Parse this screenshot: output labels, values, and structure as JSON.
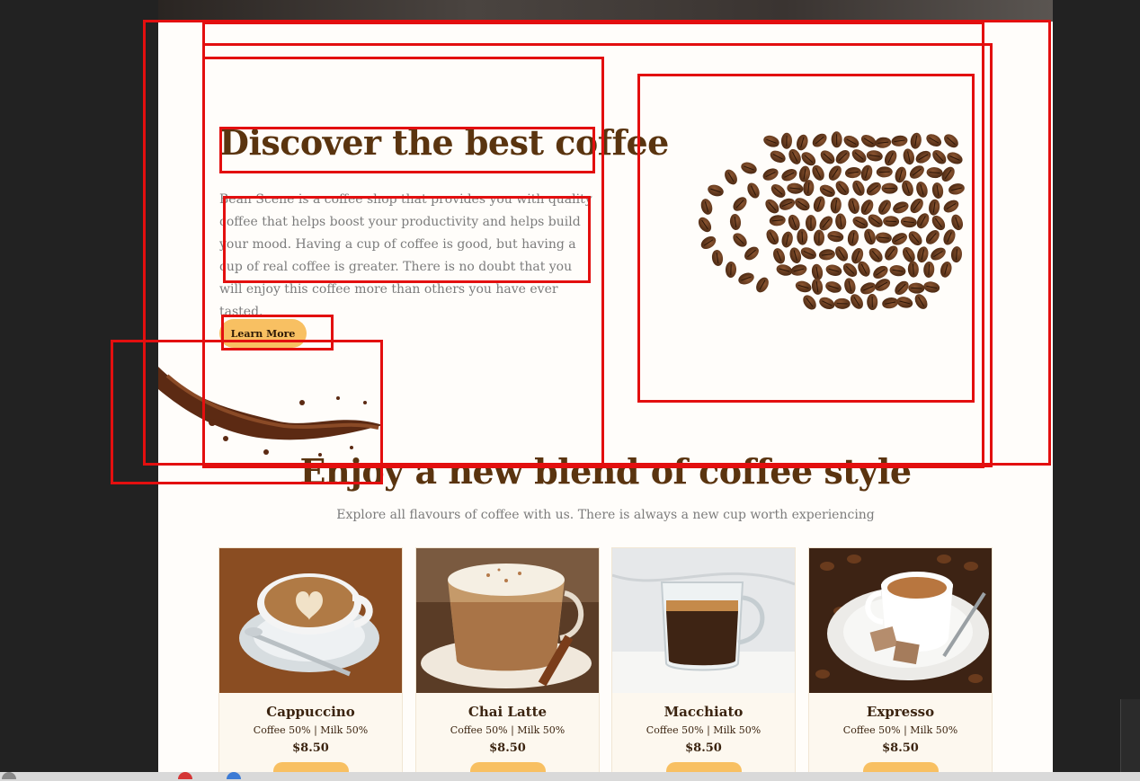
{
  "hero": {
    "title": "Discover the best coffee",
    "text": "Bean Scene is a coffee shop that provides you with quality coffee that helps boost your productivity and helps build your mood. Having a cup of coffee is good, but having a cup of real coffee is greater. There is no doubt that you will enjoy this coffee more than others you have ever tasted.",
    "button": "Learn More"
  },
  "section": {
    "title": "Enjoy a new blend of coffee style",
    "subtitle": "Explore all flavours of coffee with us. There is always a new cup worth experiencing"
  },
  "products": [
    {
      "name": "Cappuccino",
      "desc": "Coffee 50% | Milk 50%",
      "price": "$8.50"
    },
    {
      "name": "Chai Latte",
      "desc": "Coffee 50% | Milk 50%",
      "price": "$8.50"
    },
    {
      "name": "Macchiato",
      "desc": "Coffee 50% | Milk 50%",
      "price": "$8.50"
    },
    {
      "name": "Expresso",
      "desc": "Coffee 50% | Milk 50%",
      "price": "$8.50"
    }
  ],
  "colors": {
    "accent": "#f8c062",
    "heading": "#5a340f",
    "annotation": "#e30f0f"
  }
}
